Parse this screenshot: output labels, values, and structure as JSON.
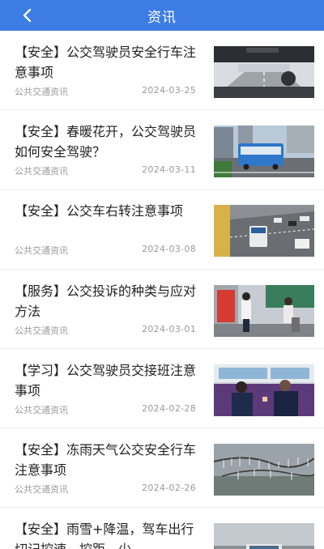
{
  "header": {
    "title": "资讯",
    "back_icon": "chevron-left-icon"
  },
  "articles": [
    {
      "title": "【安全】公交驾驶员安全行车注意事项",
      "source": "公共交通资讯",
      "date": "2024-03-25"
    },
    {
      "title": "【安全】春暖花开，公交驾驶员如何安全驾驶？",
      "source": "公共交通资讯",
      "date": "2024-03-11"
    },
    {
      "title": "【安全】公交车右转注意事项",
      "source": "公共交通资讯",
      "date": "2024-03-08"
    },
    {
      "title": "【服务】公交投诉的种类与应对方法",
      "source": "公共交通资讯",
      "date": "2024-03-01"
    },
    {
      "title": "【学习】公交驾驶员交接班注意事项",
      "source": "公共交通资讯",
      "date": "2024-02-28"
    },
    {
      "title": "【安全】冻雨天气公交安全行车注意事项",
      "source": "公共交通资讯",
      "date": "2024-02-26"
    },
    {
      "title": "【安全】雨雪+降温，驾车出行切记控速、控距、少…",
      "source": "",
      "date": ""
    }
  ]
}
